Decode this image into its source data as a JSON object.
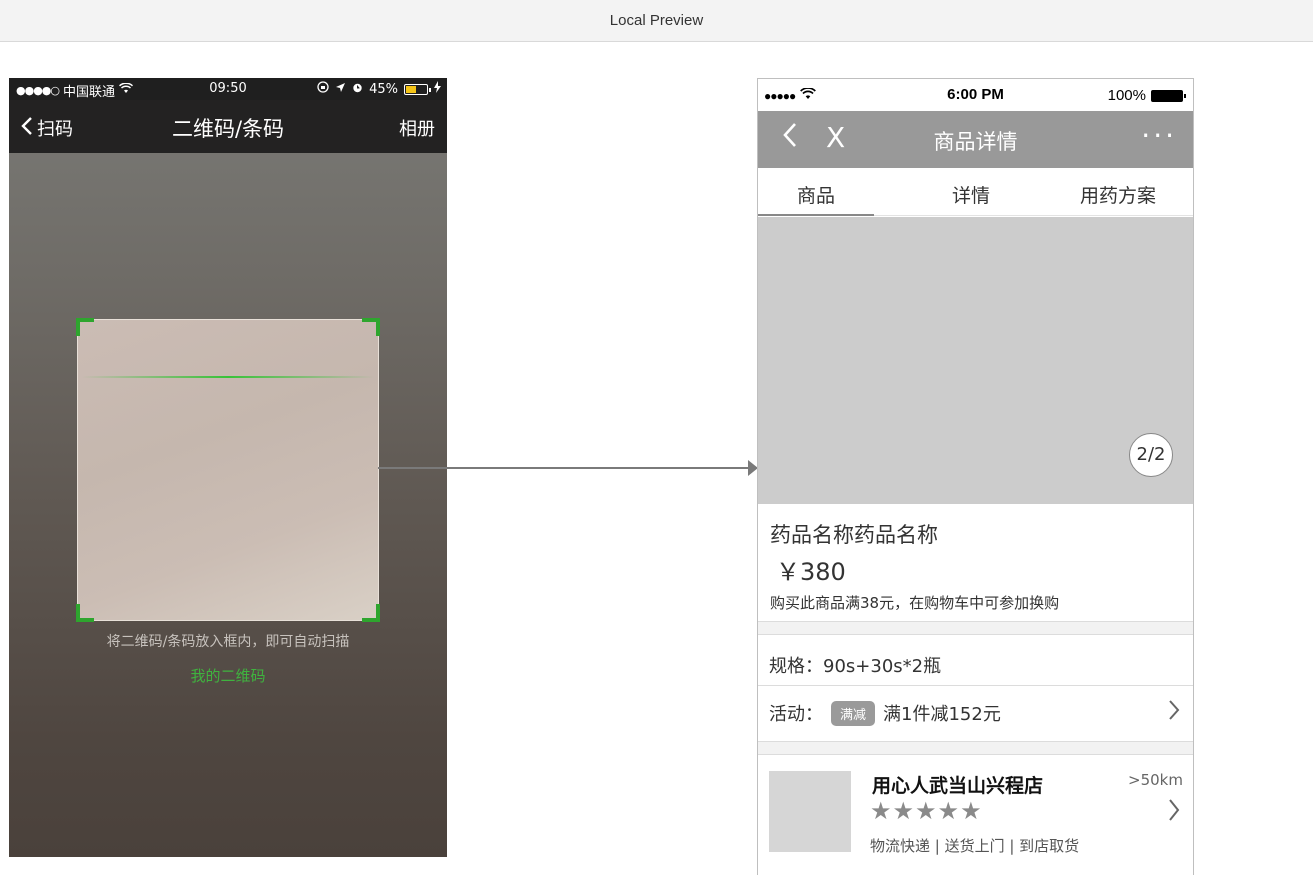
{
  "window": {
    "title": "Local Preview"
  },
  "scanner": {
    "status_bar": {
      "signal": "●●●●○",
      "carrier": "中国联通",
      "time": "09:50",
      "battery": "45%"
    },
    "nav": {
      "back_label": "扫码",
      "title": "二维码/条码",
      "album_label": "相册"
    },
    "hint": "将二维码/条码放入框内，即可自动扫描",
    "my_qr": "我的二维码"
  },
  "product_page": {
    "status_bar": {
      "signal": "●●●●●",
      "time": "6:00 PM",
      "battery": "100%"
    },
    "nav": {
      "back_glyph": "<",
      "close_glyph": "X",
      "title": "商品详情",
      "more_glyph": "···"
    },
    "tabs": [
      {
        "label": "商品",
        "active": true
      },
      {
        "label": "详情",
        "active": false
      },
      {
        "label": "用药方案",
        "active": false
      }
    ],
    "gallery": {
      "pager": "2/2",
      "progress": 1.0
    },
    "product": {
      "name": "药品名称药品名称",
      "price": "￥380",
      "promo": "购买此商品满38元，在购物车中可参加换购"
    },
    "spec": {
      "text": "规格：90s+30s*2瓶"
    },
    "activity": {
      "label": "活动：",
      "badge": "满减",
      "text": "满1件减152元"
    },
    "store": {
      "name": "用心人武当山兴程店",
      "distance": ">50km",
      "rating": 5,
      "stars": "★★★★★",
      "options": "物流快递 | 送货上门 | 到店取货"
    }
  },
  "colors": {
    "scan_green": "#2ea52e",
    "nav_gray": "#999999",
    "hero_gray": "#cccccc"
  }
}
